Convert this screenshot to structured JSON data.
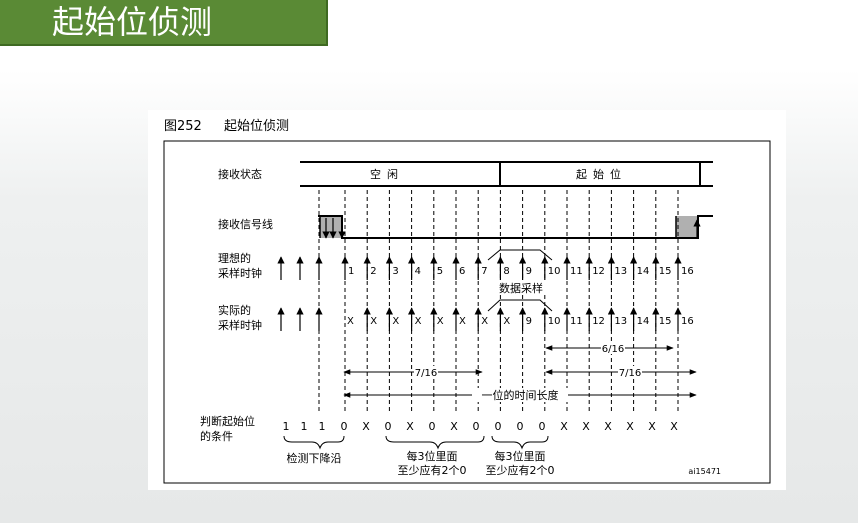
{
  "slide": {
    "title": "起始位侦测"
  },
  "figure": {
    "caption_num": "图252",
    "caption_title": "起始位侦测",
    "id": "ai15471",
    "rows": {
      "rx_state": "接收状态",
      "rx_line": "接收信号线",
      "ideal_1": "理想的",
      "ideal_2": "采样时钟",
      "actual_1": "实际的",
      "actual_2": "采样时钟",
      "cond_1": "判断起始位",
      "cond_2": "的条件"
    },
    "states": {
      "idle": "空闲",
      "start": "起始位"
    },
    "ideal_labels": [
      "1",
      "2",
      "3",
      "4",
      "5",
      "6",
      "7",
      "8",
      "9",
      "10",
      "11",
      "12",
      "13",
      "14",
      "15",
      "16"
    ],
    "actual_labels": [
      "X",
      "X",
      "X",
      "X",
      "X",
      "X",
      "X",
      "9",
      "10",
      "11",
      "12",
      "13",
      "14",
      "15",
      "16"
    ],
    "x_mark": "X",
    "x8_mark": "X",
    "data_sampling": "数据采样",
    "dim_6_16": "6/16",
    "dim_7_16_left": "7/16",
    "dim_7_16_right": "7/16",
    "bit_time": "一位的时间长度",
    "conditions": [
      "1",
      "1",
      "1",
      "0",
      "X",
      "0",
      "X",
      "0",
      "X",
      "0",
      "0",
      "0",
      "0",
      "X",
      "X",
      "X",
      "X",
      "X",
      "X"
    ],
    "note_falling": "检测下降沿",
    "note_group_1a": "每3位里面",
    "note_group_1b": "至少应有2个0",
    "note_group_2a": "每3位里面",
    "note_group_2b": "至少应有2个0"
  }
}
